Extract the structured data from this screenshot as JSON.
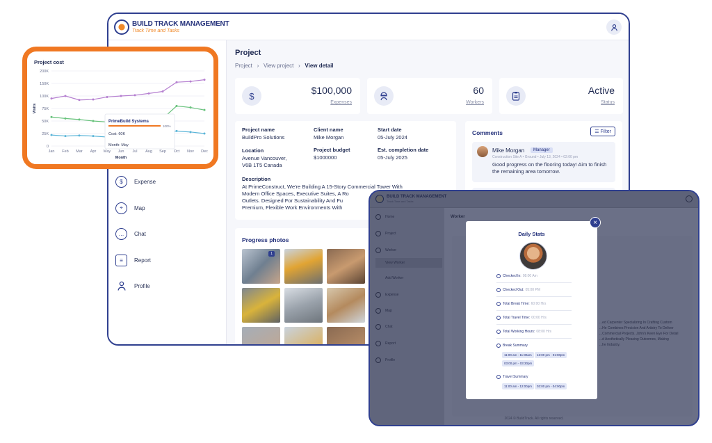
{
  "app": {
    "brand": "BUILD TRACK MANAGEMENT",
    "tagline": "Track Time and Tasks"
  },
  "sidebar": {
    "items": [
      {
        "label": "Expense",
        "icon": "dollar-icon"
      },
      {
        "label": "Map",
        "icon": "map-pin-icon"
      },
      {
        "label": "Chat",
        "icon": "chat-icon"
      },
      {
        "label": "Report",
        "icon": "report-icon"
      },
      {
        "label": "Profile",
        "icon": "profile-icon"
      }
    ]
  },
  "page": {
    "title": "Project",
    "breadcrumb": [
      "Project",
      "View project",
      "View detail"
    ]
  },
  "stats": [
    {
      "value": "$100,000",
      "label": "Expenses",
      "icon": "dollar-icon"
    },
    {
      "value": "60",
      "label": "Workers",
      "icon": "worker-icon"
    },
    {
      "value": "Active",
      "label": "Status",
      "icon": "clipboard-icon"
    }
  ],
  "project": {
    "name_label": "Project name",
    "name": "BuildPro Solutions",
    "client_label": "Client name",
    "client": "Mike Morgan",
    "start_label": "Start date",
    "start": "05-July 2024",
    "location_label": "Location",
    "location_1": "Avenue Vancouver,",
    "location_2": "V6B 1T5 Canada",
    "budget_label": "Project budget",
    "budget": "$1000000",
    "completion_label": "Est. completion date",
    "completion": "05-July 2025",
    "description_label": "Description",
    "description_1": "At PrimeConstruct, We're Building A 15-Story Commercial Tower With",
    "description_2": "Modern Office Spaces, Executive Suites, A Ro",
    "description_3": "Outlets. Designed For Sustainability And Fu",
    "description_4": "Premium, Flexible Work Environments With"
  },
  "comments": {
    "title": "Comments",
    "filter_label": "Filter",
    "items": [
      {
        "name": "Mike Morgan",
        "role": "Manager",
        "meta": "Construction Site A  •  Ground  •  July 13, 2024  •  02:00 pm",
        "text": "Good progress on the flooring today! Aim to finish the remaining area tomorrow."
      }
    ]
  },
  "photos": {
    "title": "Progress photos",
    "badge": "1"
  },
  "chart_data": {
    "type": "line",
    "title": "Project cost",
    "ylabel": "Visits",
    "xlabel": "Month",
    "categories": [
      "Jan",
      "Feb",
      "Mar",
      "Apr",
      "May",
      "Jun",
      "Jul",
      "Aug",
      "Sep",
      "Oct",
      "Nov",
      "Dec"
    ],
    "y_ticks": [
      "0",
      "25K",
      "50K",
      "75K",
      "100K",
      "150K",
      "200K"
    ],
    "ylim": [
      0,
      200000
    ],
    "series": [
      {
        "color": "#b57fd0",
        "values": [
          95000,
          100000,
          92000,
          93000,
          98000,
          100000,
          103000,
          110000,
          118000,
          155000,
          158000,
          165000
        ]
      },
      {
        "color": "#67c27b",
        "values": [
          58000,
          55000,
          53000,
          50000,
          48000,
          46000,
          47000,
          52000,
          55000,
          80000,
          77000,
          72000
        ]
      },
      {
        "color": "#5bb5d8",
        "values": [
          22000,
          20000,
          21000,
          20000,
          18000,
          21000,
          24000,
          29000,
          27000,
          30000,
          28000,
          25000
        ]
      }
    ],
    "tooltip": {
      "title": "PrimeBuild Systems",
      "percent": "100%",
      "cost": "Cost: 60K",
      "month": "Month: May"
    },
    "grid": true
  },
  "overlay": {
    "brand": "BUILD TRACK MANAGEMENT",
    "tagline": "Track Time and Tasks",
    "nav": [
      "Home",
      "Project",
      "Worker",
      "View Worker",
      "Add Worker",
      "Expense",
      "Map",
      "Chat",
      "Report",
      "Profile"
    ],
    "header": "Worker",
    "footer": "2024 © BuildTrack. All rights reserved.",
    "bio_1": "...ed Carpenter Specializing In Crafting Custom",
    "bio_2": "...He Combines Precision And Artistry To Deliver",
    "bio_3": "...Commercial Projects. John's Keen Eye For Detail",
    "bio_4": "...d Aesthetically Pleasing Outcomes, Making",
    "bio_5": "...he Industry."
  },
  "modal": {
    "title": "Daily Stats",
    "checked_in_label": "Checked In:",
    "checked_in": "08:00 Am",
    "checked_out_label": "Checked Out:",
    "checked_out": "05:00 PM",
    "break_label": "Total Break Time:",
    "break": "60:00 Hrs",
    "travel_label": "Total Travel Time:",
    "travel": "00:00 Hrs",
    "working_label": "Total Working Hours:",
    "working": "08:00 Hrs",
    "break_summary_label": "Break Summary",
    "break_chips": [
      "11:00 am - 11:30am",
      "12:00 pm - 01:00pm",
      "03:00 pm - 03:30pm"
    ],
    "travel_summary_label": "Travel Summary",
    "travel_chips": [
      "11:00 am - 12:00pm",
      "03:00 pm - 04:00pm"
    ]
  }
}
